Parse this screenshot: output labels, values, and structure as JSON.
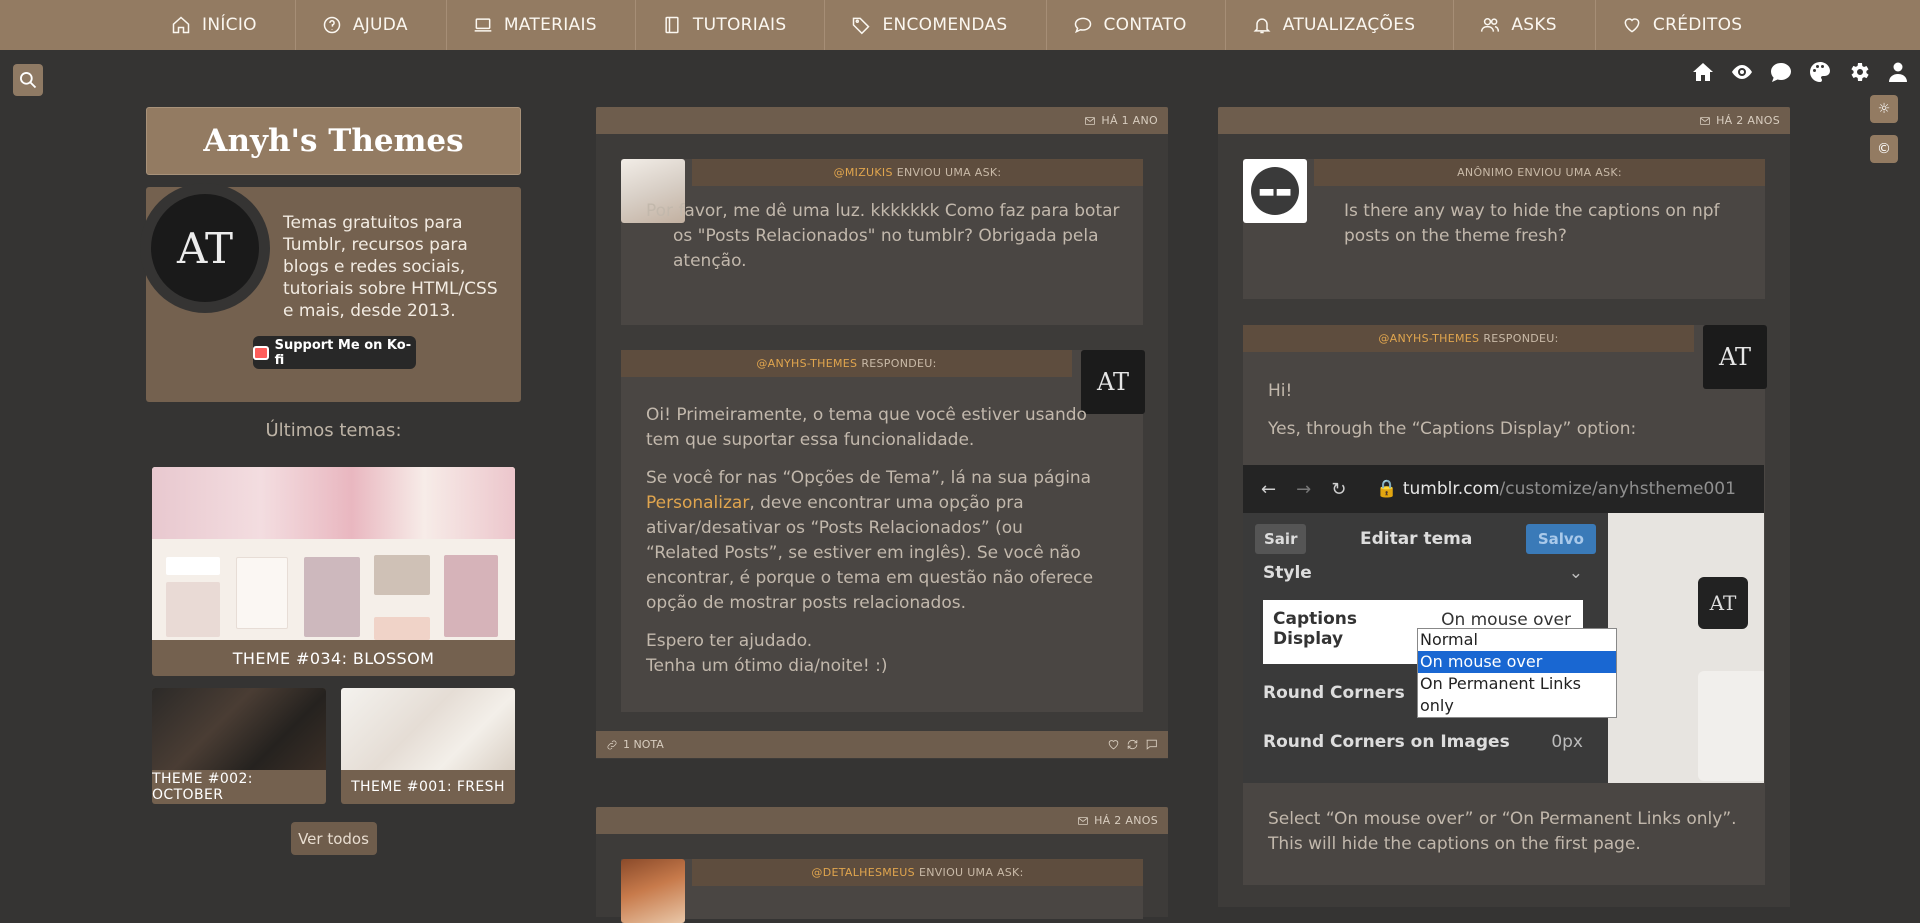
{
  "nav": [
    {
      "label": "INÍCIO",
      "icon": "home-icon"
    },
    {
      "label": "AJUDA",
      "icon": "help-icon"
    },
    {
      "label": "MATERIAIS",
      "icon": "laptop-icon"
    },
    {
      "label": "TUTORIAIS",
      "icon": "book-icon"
    },
    {
      "label": "ENCOMENDAS",
      "icon": "tag-icon"
    },
    {
      "label": "CONTATO",
      "icon": "chat-icon"
    },
    {
      "label": "ATUALIZAÇÕES",
      "icon": "bell-icon"
    },
    {
      "label": "ASKS",
      "icon": "users-icon"
    },
    {
      "label": "CRÉDITOS",
      "icon": "heart-icon"
    }
  ],
  "sidebar": {
    "title": "Anyh's Themes",
    "avatar_text": "AT",
    "description": "Temas gratuitos para Tumblr, recursos para blogs e redes sociais, tutoriais sobre HTML/CSS e mais, desde 2013.",
    "kofi_label": "Support Me on Ko-fi",
    "latest_label": "Últimos temas:",
    "themes": [
      "THEME #034: BLOSSOM",
      "THEME #002: OCTOBER",
      "THEME #001: FRESH"
    ],
    "see_all": "Ver todos"
  },
  "post1": {
    "time": "HÁ 1 ANO",
    "ask_user": "@MIZUKIS",
    "ask_suffix": "ENVIOU UMA ASK:",
    "question": "Por favor, me dê uma luz. kkkkkkk Como faz para botar os \"Posts Relacionados\" no tumblr? Obrigada pela atenção.",
    "answer_user": "@ANYHS-THEMES",
    "answer_suffix": "RESPONDEU:",
    "answer_p1": "Oi! Primeiramente, o tema que você estiver usando tem que suportar essa funcionalidade.",
    "answer_p2a": "Se você for nas “Opções de Tema”, lá na sua página ",
    "answer_link": "Personalizar",
    "answer_p2b": ", deve encontrar uma opção pra ativar/desativar os “Posts Relacionados” (ou “Related Posts”, se estiver em inglês). Se você não encontrar, é porque o tema em questão não oferece opção de mostrar posts relacionados.",
    "answer_p3a": "Espero ter ajudado.",
    "answer_p3b": "Tenha um ótimo dia/noite! :)",
    "notes": "1 NOTA"
  },
  "post2": {
    "time": "HÁ 2 ANOS",
    "ask_user": "ANÔNIMO",
    "ask_suffix": "ENVIOU UMA ASK:",
    "question": "Is there any way to hide the captions on npf posts on the theme fresh?",
    "answer_user": "@ANYHS-THEMES",
    "answer_suffix": "RESPONDEU:",
    "answer_p1": "Hi!",
    "answer_p2": "Yes, through the “Captions Display” option:",
    "answer_p3": "Select “On mouse over” or “On Permanent Links only”. This will hide the captions on the first page.",
    "screenshot": {
      "url_domain": "tumblr.com",
      "url_path": "/customize/anyhstheme001",
      "exit": "Sair",
      "title": "Editar tema",
      "saved": "Salvo",
      "style_label": "Style",
      "captions_label": "Captions Display",
      "captions_value": "On mouse over",
      "round_corners": "Round Corners",
      "round_corners_images": "Round Corners on Images",
      "round_corners_images_value": "0px",
      "options": [
        "Normal",
        "On mouse over",
        "On Permanent Links only"
      ],
      "selected_option": "On mouse over"
    }
  },
  "post3": {
    "time": "HÁ 2 ANOS",
    "ask_user": "@DETALHESMEUS",
    "ask_suffix": "ENVIOU UMA ASK:"
  }
}
